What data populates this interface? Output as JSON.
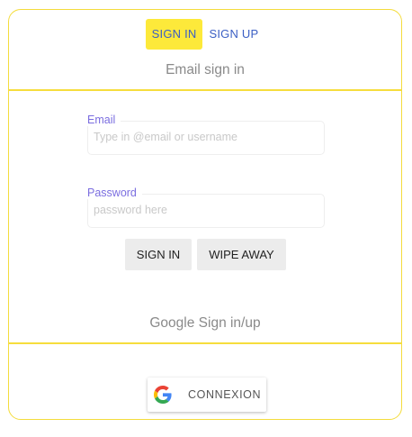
{
  "tabs": {
    "sign_in": "SIGN IN",
    "sign_up": "SIGN UP"
  },
  "email_section": {
    "title": "Email sign in",
    "email_label": "Email",
    "email_placeholder": "Type in @email or username",
    "email_value": "",
    "password_label": "Password",
    "password_placeholder": "password here",
    "password_value": "",
    "sign_in_button": "SIGN IN",
    "wipe_button": "WIPE AWAY"
  },
  "google_section": {
    "title": "Google Sign in/up",
    "button_label": "CONNEXION",
    "icon": "google-icon"
  },
  "colors": {
    "accent_yellow": "#fde93a",
    "border_yellow": "#f4dc3c",
    "link_blue": "#3b5fc4",
    "label_purple": "#7b6ee0",
    "button_gray": "#ececec"
  }
}
